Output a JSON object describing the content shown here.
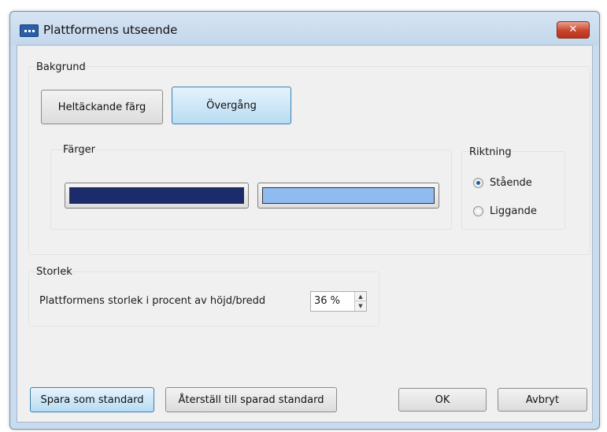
{
  "window": {
    "title": "Plattformens utseende",
    "close_label": "✕"
  },
  "background": {
    "label": "Bakgrund",
    "solid_button": "Heltäckande färg",
    "gradient_button": "Övergång",
    "colors_label": "Färger",
    "color1": "#1b2b6b",
    "color2": "#8fbbf0",
    "direction_label": "Riktning",
    "options": [
      {
        "label": "Stående",
        "checked": true
      },
      {
        "label": "Liggande",
        "checked": false
      }
    ]
  },
  "size": {
    "label": "Storlek",
    "field_label": "Plattformens storlek i procent av höjd/bredd",
    "value": "36 %"
  },
  "footer": {
    "save_default": "Spara som standard",
    "restore_default": "Återställ till sparad standard",
    "ok": "OK",
    "cancel": "Avbryt"
  }
}
